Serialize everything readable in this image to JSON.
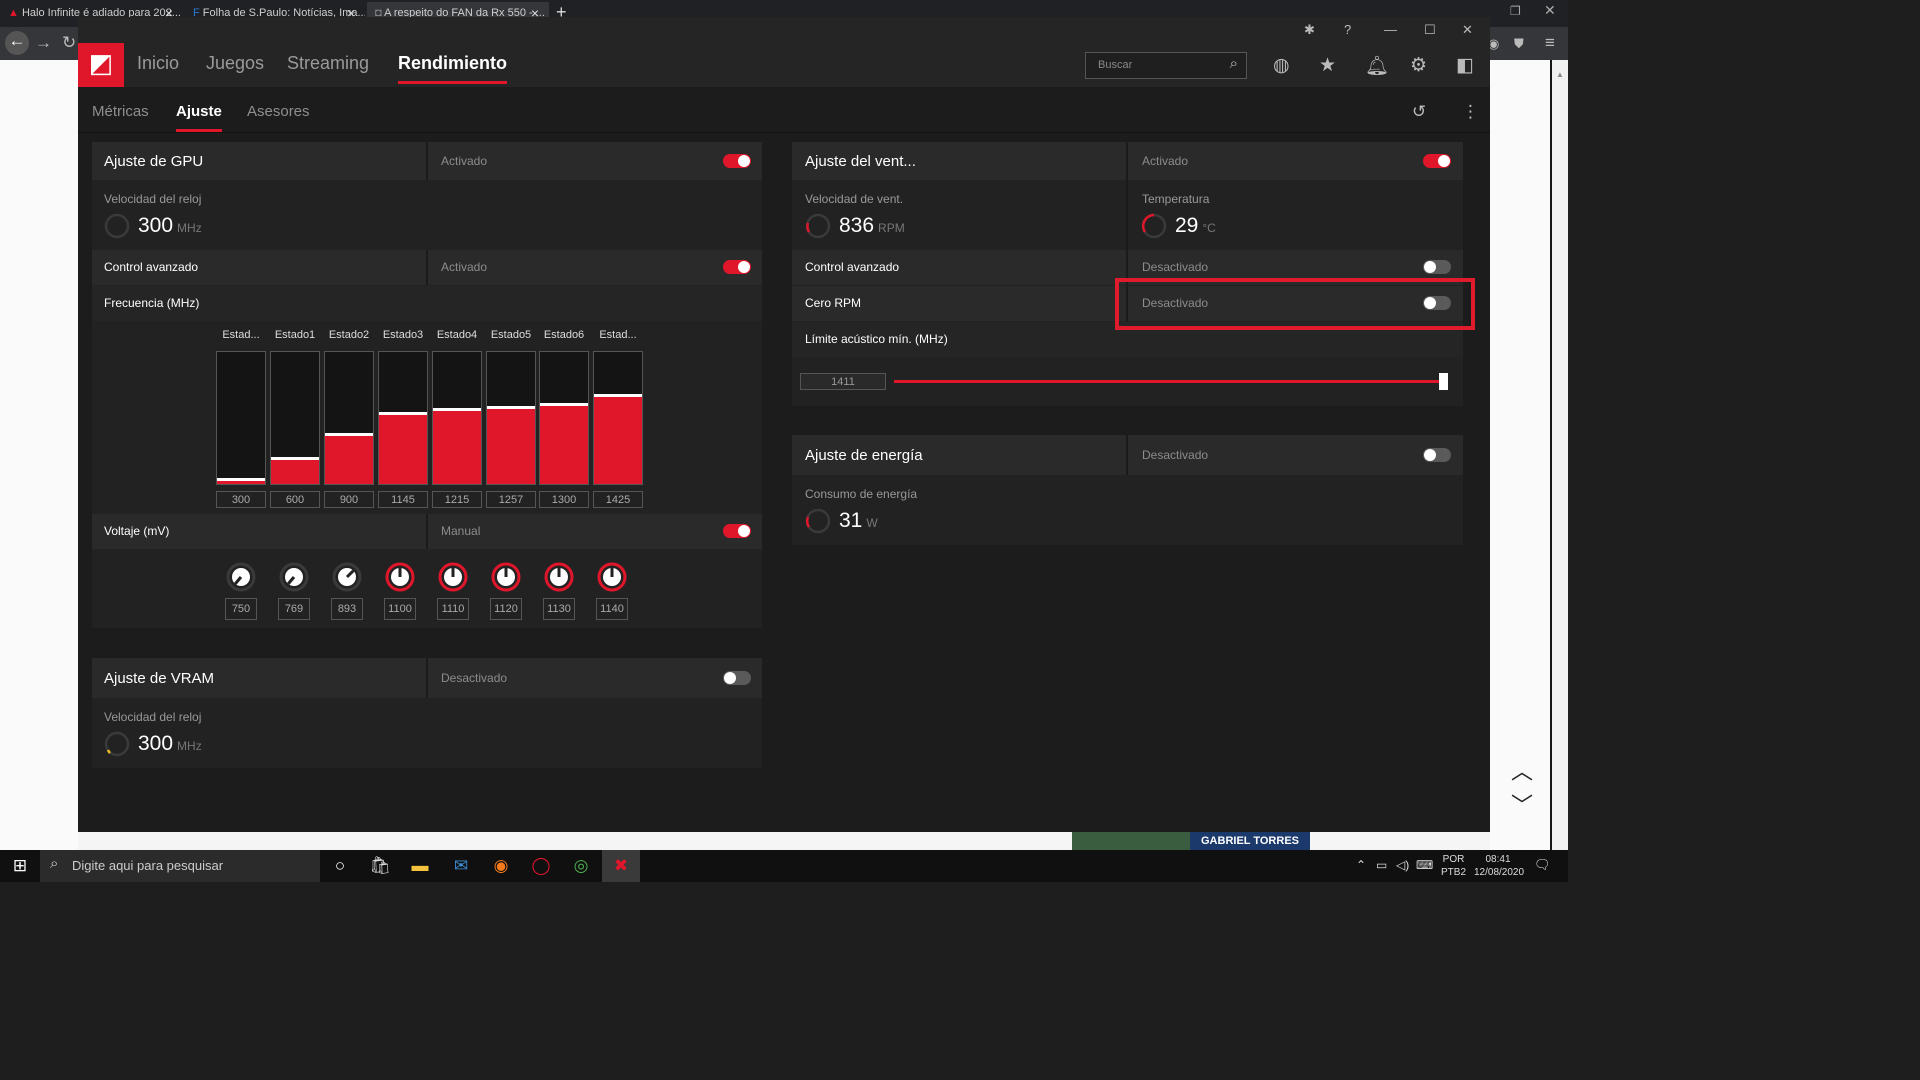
{
  "browser": {
    "tabs": [
      {
        "title": "Halo Infinite é adiado para 202..."
      },
      {
        "title": "Folha de S.Paulo: Notícias, Ima..."
      },
      {
        "title": "A respeito do FAN da Rx 550 - ..."
      }
    ],
    "new_tab": "+"
  },
  "app": {
    "nav": [
      "Inicio",
      "Juegos",
      "Streaming",
      "Rendimiento"
    ],
    "search_placeholder": "Buscar",
    "subtabs": [
      "Métricas",
      "Ajuste",
      "Asesores"
    ]
  },
  "gpu": {
    "title": "Ajuste de GPU",
    "status": "Activado",
    "clock_label": "Velocidad del reloj",
    "clock_value": "300",
    "clock_unit": "MHz",
    "advanced_label": "Control avanzado",
    "advanced_status": "Activado",
    "freq_label": "Frecuencia (MHz)",
    "states": [
      "Estad...",
      "Estado1",
      "Estado2",
      "Estado3",
      "Estado4",
      "Estado5",
      "Estado6",
      "Estad..."
    ],
    "frequencies": [
      "300",
      "600",
      "900",
      "1145",
      "1215",
      "1257",
      "1300",
      "1425"
    ],
    "freq_levels": [
      0.02,
      0.18,
      0.36,
      0.52,
      0.55,
      0.57,
      0.59,
      0.66
    ],
    "voltage_label": "Voltaje (mV)",
    "voltage_status": "Manual",
    "voltages": [
      "750",
      "769",
      "893",
      "1100",
      "1110",
      "1120",
      "1130",
      "1140"
    ]
  },
  "vram": {
    "title": "Ajuste de VRAM",
    "status": "Desactivado",
    "clock_label": "Velocidad del reloj",
    "clock_value": "300",
    "clock_unit": "MHz"
  },
  "fan": {
    "title": "Ajuste del vent...",
    "status": "Activado",
    "speed_label": "Velocidad de vent.",
    "speed_value": "836",
    "speed_unit": "RPM",
    "temp_label": "Temperatura",
    "temp_value": "29",
    "temp_unit": "°C",
    "advanced_label": "Control avanzado",
    "advanced_status": "Desactivado",
    "zero_rpm_label": "Cero RPM",
    "zero_rpm_status": "Desactivado",
    "acoustic_label": "Límite acústico mín. (MHz)",
    "acoustic_value": "1411",
    "acoustic_level": 1.0
  },
  "power": {
    "title": "Ajuste de energía",
    "status": "Desactivado",
    "consumption_label": "Consumo de energía",
    "consumption_value": "31",
    "consumption_unit": "W"
  },
  "page": {
    "ad_text": "GABRIEL TORRES"
  },
  "taskbar": {
    "search_placeholder": "Digite aqui para pesquisar",
    "lang": "POR",
    "layout": "PTB2",
    "time": "08:41",
    "date": "12/08/2020"
  },
  "colors": {
    "accent": "#e0162b",
    "highlight": "#e01b2b"
  }
}
